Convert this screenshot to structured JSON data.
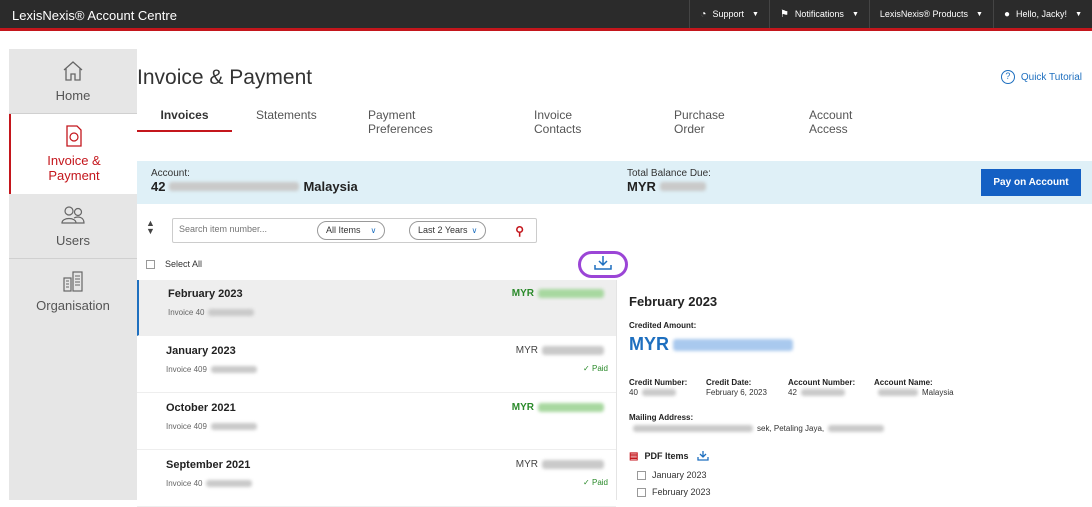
{
  "topbar": {
    "brand": "LexisNexis® Account Centre",
    "support": "Support",
    "notifications": "Notifications",
    "products": "LexisNexis® Products",
    "greeting": "Hello, Jacky!"
  },
  "sidebar": {
    "items": [
      {
        "label": "Home",
        "icon": "home-icon"
      },
      {
        "label": "Invoice & Payment",
        "icon": "invoice-icon"
      },
      {
        "label": "Users",
        "icon": "users-icon"
      },
      {
        "label": "Organisation",
        "icon": "building-icon"
      }
    ]
  },
  "page": {
    "title": "Invoice & Payment",
    "help": "Quick Tutorial"
  },
  "tabs": [
    "Invoices",
    "Statements",
    "Payment Preferences",
    "Invoice Contacts",
    "Purchase Order",
    "Account Access"
  ],
  "account": {
    "label": "Account:",
    "prefix": "42",
    "country": "Malaysia",
    "balance_label": "Total Balance Due:",
    "currency": "MYR",
    "pay_button": "Pay on Account"
  },
  "filters": {
    "search_placeholder": "Search item number...",
    "items": "All Items",
    "period": "Last 2 Years",
    "select_all": "Select All"
  },
  "invoices": [
    {
      "month": "February 2023",
      "invoice": "Invoice 40",
      "currency": "MYR",
      "paid": ""
    },
    {
      "month": "January 2023",
      "invoice": "Invoice 409",
      "currency": "MYR",
      "paid": "Paid"
    },
    {
      "month": "October 2021",
      "invoice": "Invoice 409",
      "currency": "MYR",
      "paid": ""
    },
    {
      "month": "September 2021",
      "invoice": "Invoice 40",
      "currency": "MYR",
      "paid": "Paid"
    }
  ],
  "detail": {
    "title": "February 2023",
    "credited_label": "Credited Amount:",
    "currency": "MYR",
    "credit_number_label": "Credit Number:",
    "credit_number": "40",
    "credit_date_label": "Credit Date:",
    "credit_date": "February 6, 2023",
    "account_number_label": "Account Number:",
    "account_number": "42",
    "account_name_label": "Account Name:",
    "account_name": "Malaysia",
    "mailing_label": "Mailing Address:",
    "mailing": "sek, Petaling Jaya,",
    "pdf_label": "PDF Items",
    "pdf_items": [
      "January 2023",
      "February 2023"
    ]
  },
  "colors": {
    "accent": "#c4161c",
    "primary": "#1460c4",
    "highlight": "#9b45d6"
  }
}
